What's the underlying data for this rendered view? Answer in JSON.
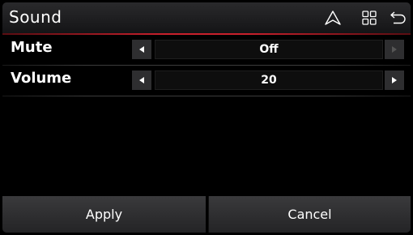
{
  "header": {
    "title": "Sound",
    "icons": [
      "navigation-icon",
      "menu-grid-icon",
      "back-icon"
    ]
  },
  "settings": [
    {
      "label": "Mute",
      "value": "Off",
      "left_enabled": true,
      "right_enabled": false
    },
    {
      "label": "Volume",
      "value": "20",
      "left_enabled": true,
      "right_enabled": true
    }
  ],
  "footer": {
    "apply_label": "Apply",
    "cancel_label": "Cancel"
  },
  "colors": {
    "accent": "#c8202c",
    "background": "#000000",
    "button": "#2e2e30",
    "disabled_arrow": "#555555"
  }
}
